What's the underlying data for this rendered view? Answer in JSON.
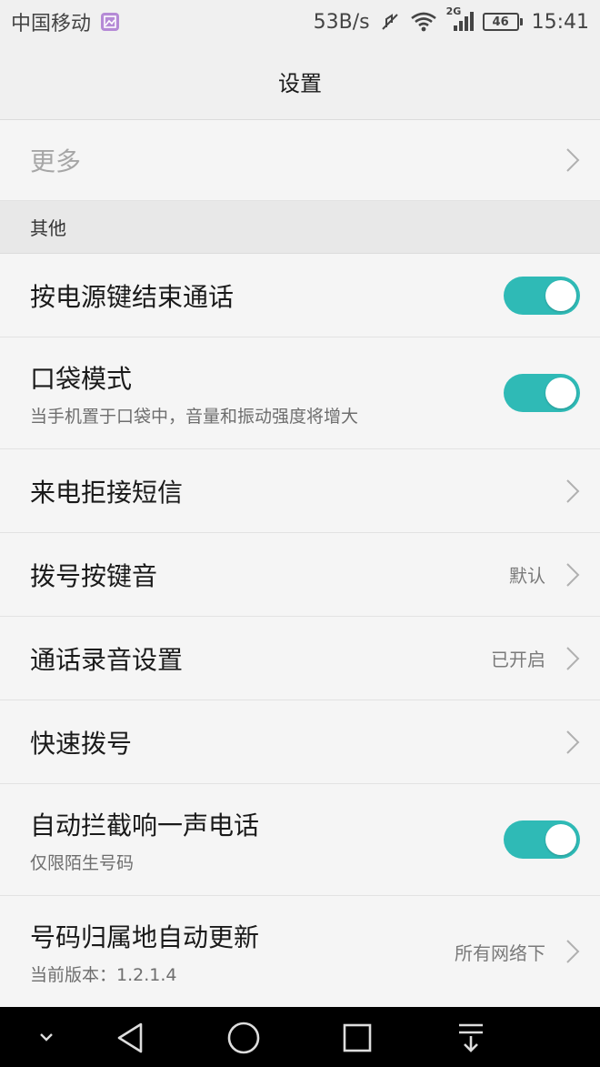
{
  "status_bar": {
    "carrier": "中国移动",
    "speed": "53B/s",
    "network_type": "2G",
    "battery": "46",
    "time": "15:41",
    "icons": [
      "gallery-icon",
      "mute-icon",
      "wifi-icon",
      "signal-icon",
      "battery-icon"
    ]
  },
  "header": {
    "title": "设置"
  },
  "rows_top": [
    {
      "label": "更多",
      "muted": true
    }
  ],
  "section": {
    "title": "其他"
  },
  "settings": [
    {
      "label": "按电源键结束通话",
      "type": "toggle",
      "on": true
    },
    {
      "label": "口袋模式",
      "sub": "当手机置于口袋中，音量和振动强度将增大",
      "type": "toggle",
      "on": true
    },
    {
      "label": "来电拒接短信",
      "type": "link"
    },
    {
      "label": "拨号按键音",
      "value": "默认",
      "type": "link"
    },
    {
      "label": "通话录音设置",
      "value": "已开启",
      "type": "link"
    },
    {
      "label": "快速拨号",
      "type": "link"
    },
    {
      "label": "自动拦截响一声电话",
      "sub": "仅限陌生号码",
      "type": "toggle",
      "on": true
    },
    {
      "label": "号码归属地自动更新",
      "sub": "当前版本：1.2.1.4",
      "value": "所有网络下",
      "type": "link"
    }
  ],
  "colors": {
    "accent": "#2fbab6",
    "background": "#f5f5f5",
    "section": "#e8e8e8"
  },
  "nav": [
    "collapse-icon",
    "back-icon",
    "home-icon",
    "recents-icon",
    "notification-pull-icon"
  ]
}
